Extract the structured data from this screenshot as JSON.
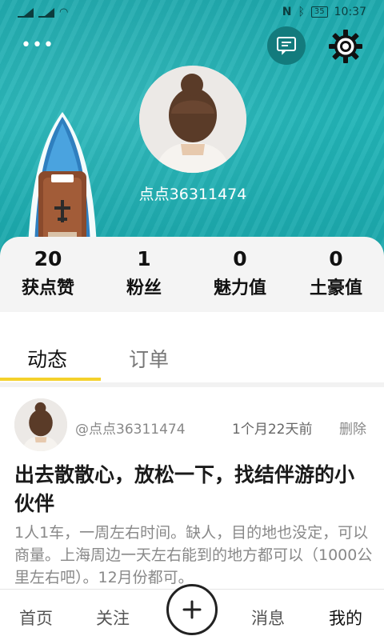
{
  "status_bar": {
    "time": "10:37",
    "battery": "35"
  },
  "header": {
    "more_icon": "more-dots-icon",
    "message_icon": "message-icon",
    "settings_icon": "gear-icon"
  },
  "profile": {
    "username": "点点36311474"
  },
  "stats": [
    {
      "value": "20",
      "label": "获点赞"
    },
    {
      "value": "1",
      "label": "粉丝"
    },
    {
      "value": "0",
      "label": "魅力值"
    },
    {
      "value": "0",
      "label": "土豪值"
    }
  ],
  "tabs": [
    {
      "label": "动态",
      "active": true
    },
    {
      "label": "订单",
      "active": false
    }
  ],
  "post": {
    "user": "@点点36311474",
    "time": "1个月22天前",
    "delete_label": "删除",
    "title": "出去散散心，放松一下，找结伴游的小伙伴",
    "body": "1人1车，一周左右时间。缺人，目的地也没定，可以商量。上海周边一天左右能到的地方都可以（1000公里左右吧）。12月份都可。"
  },
  "bottom_nav": {
    "home": "首页",
    "follow": "关注",
    "add_icon": "plus-icon",
    "messages": "消息",
    "me": "我的"
  },
  "colors": {
    "accent": "#f4d12b",
    "hero": "#1fa9ad",
    "icon_bg": "#137b7d"
  }
}
